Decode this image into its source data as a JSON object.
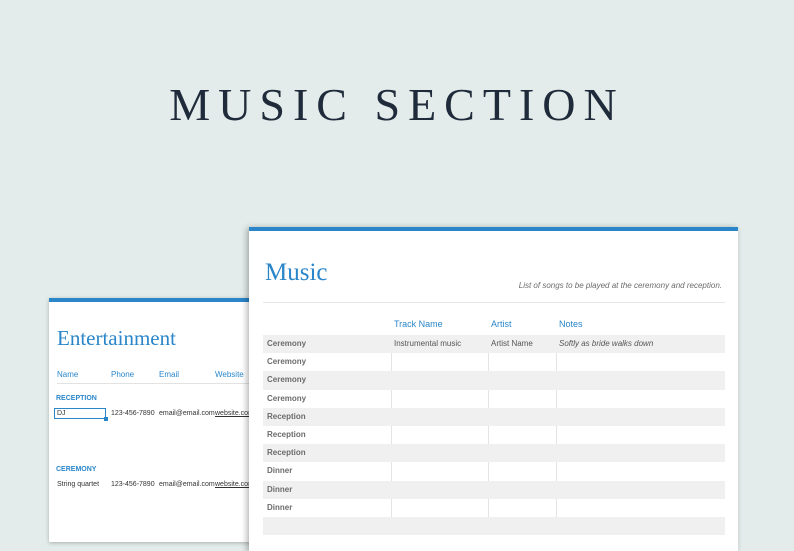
{
  "hero": {
    "title": "MUSIC SECTION"
  },
  "entertainment": {
    "title": "Entertainment",
    "columns": [
      "Name",
      "Phone",
      "Email",
      "Website"
    ],
    "sections": [
      {
        "label": "RECEPTION",
        "rows": [
          {
            "name": "DJ",
            "phone": "123-456-7890",
            "email": "email@email.com",
            "website": "website.com"
          }
        ]
      },
      {
        "label": "CEREMONY",
        "rows": [
          {
            "name": "String quartet",
            "phone": "123-456-7890",
            "email": "email@email.com",
            "website": "website.com"
          }
        ]
      }
    ]
  },
  "music": {
    "title": "Music",
    "subtitle": "List of songs to be played at the ceremony and reception.",
    "columns": [
      "Track Name",
      "Artist",
      "Notes"
    ],
    "rows": [
      {
        "name": "Ceremony",
        "track": "Instrumental music",
        "artist": "Artist Name",
        "notes": "Softly as bride walks down"
      },
      {
        "name": "Ceremony",
        "track": "",
        "artist": "",
        "notes": ""
      },
      {
        "name": "Ceremony",
        "track": "",
        "artist": "",
        "notes": ""
      },
      {
        "name": "Ceremony",
        "track": "",
        "artist": "",
        "notes": ""
      },
      {
        "name": "Reception",
        "track": "",
        "artist": "",
        "notes": ""
      },
      {
        "name": "Reception",
        "track": "",
        "artist": "",
        "notes": ""
      },
      {
        "name": "Reception",
        "track": "",
        "artist": "",
        "notes": ""
      },
      {
        "name": "Dinner",
        "track": "",
        "artist": "",
        "notes": ""
      },
      {
        "name": "Dinner",
        "track": "",
        "artist": "",
        "notes": ""
      },
      {
        "name": "Dinner",
        "track": "",
        "artist": "",
        "notes": ""
      },
      {
        "name": "",
        "track": "",
        "artist": "",
        "notes": ""
      }
    ]
  },
  "colors": {
    "accent": "#2a86c9",
    "background": "#e3ecea",
    "heading": "#1f2a3a"
  }
}
